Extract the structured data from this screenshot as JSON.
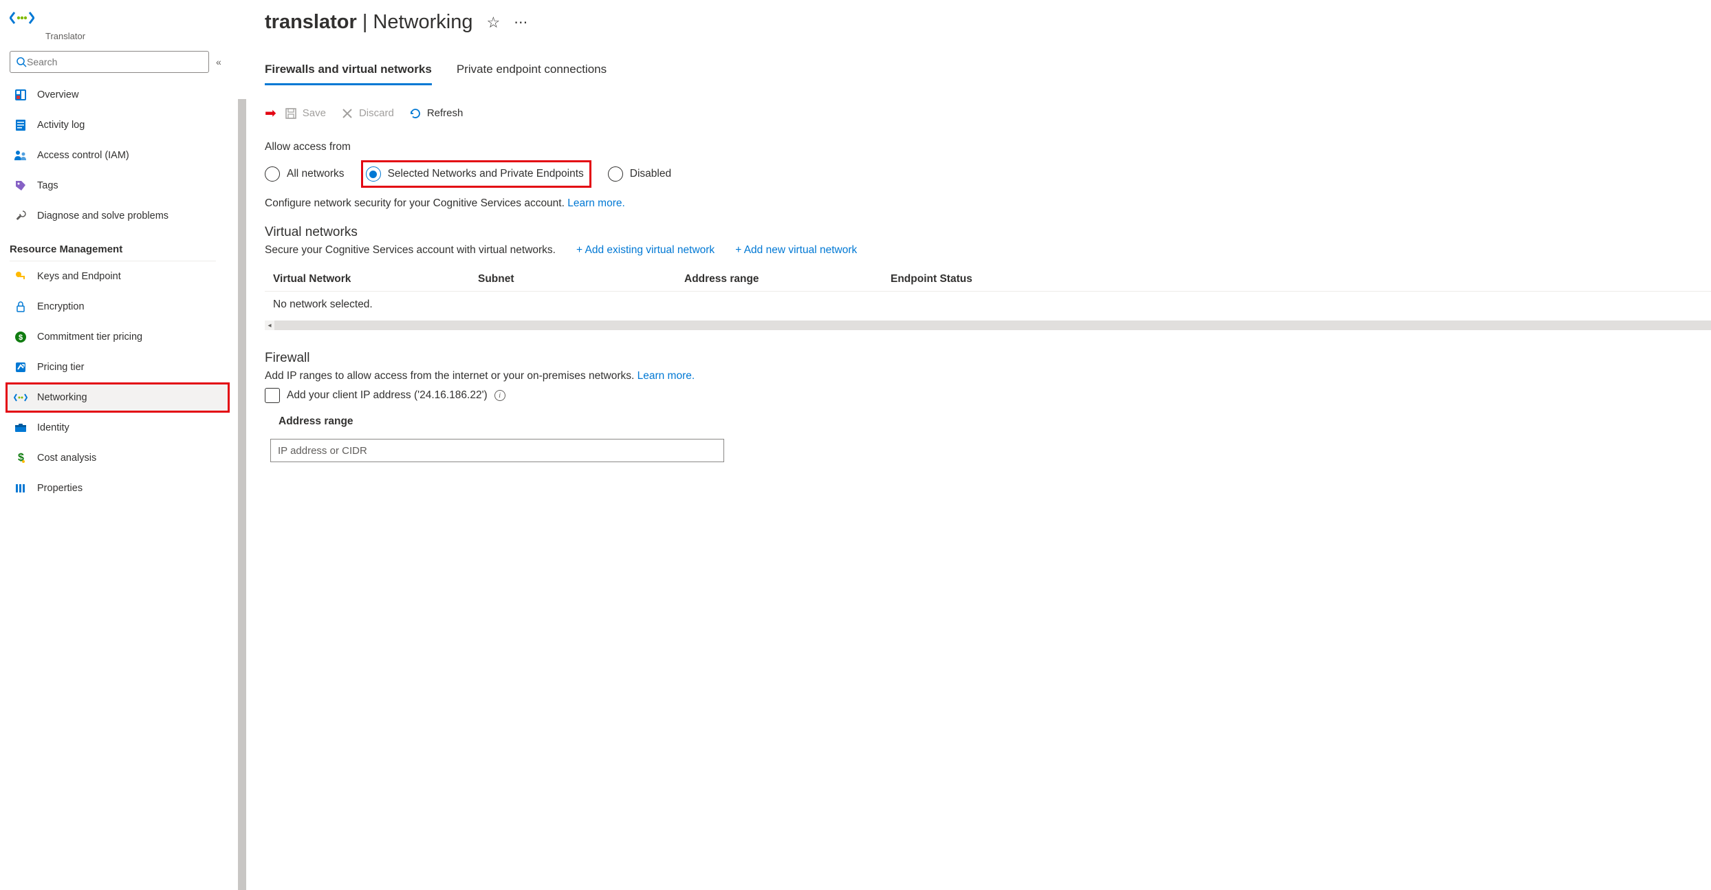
{
  "brand": {
    "label": "Translator"
  },
  "search": {
    "placeholder": "Search"
  },
  "sidebar": {
    "items": [
      {
        "label": "Overview"
      },
      {
        "label": "Activity log"
      },
      {
        "label": "Access control (IAM)"
      },
      {
        "label": "Tags"
      },
      {
        "label": "Diagnose and solve problems"
      }
    ],
    "section": "Resource Management",
    "rm_items": [
      {
        "label": "Keys and Endpoint"
      },
      {
        "label": "Encryption"
      },
      {
        "label": "Commitment tier pricing"
      },
      {
        "label": "Pricing tier"
      },
      {
        "label": "Networking"
      },
      {
        "label": "Identity"
      },
      {
        "label": "Cost analysis"
      },
      {
        "label": "Properties"
      }
    ]
  },
  "header": {
    "resource": "translator",
    "page": "Networking"
  },
  "tabs": {
    "firewalls": "Firewalls and virtual networks",
    "private": "Private endpoint connections"
  },
  "toolbar": {
    "save": "Save",
    "discard": "Discard",
    "refresh": "Refresh"
  },
  "access": {
    "label": "Allow access from",
    "all": "All networks",
    "selected": "Selected Networks and Private Endpoints",
    "disabled": "Disabled",
    "desc": "Configure network security for your Cognitive Services account.",
    "learn": "Learn more."
  },
  "vnet": {
    "title": "Virtual networks",
    "desc": "Secure your Cognitive Services account with virtual networks.",
    "add_existing": "+ Add existing virtual network",
    "add_new": "+ Add new virtual network",
    "cols": {
      "c1": "Virtual Network",
      "c2": "Subnet",
      "c3": "Address range",
      "c4": "Endpoint Status"
    },
    "empty": "No network selected."
  },
  "firewall": {
    "title": "Firewall",
    "desc": "Add IP ranges to allow access from the internet or your on-premises networks.",
    "learn": "Learn more.",
    "checkbox": "Add your client IP address ('24.16.186.22')",
    "addr_label": "Address range",
    "addr_placeholder": "IP address or CIDR"
  }
}
